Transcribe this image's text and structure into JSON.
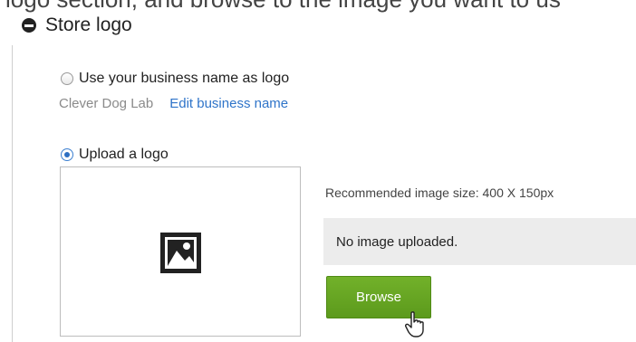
{
  "top_cut_text": "logo section, and browse to the image you want to us",
  "section": {
    "title": "Store logo",
    "collapse_icon": "minus-circle-icon"
  },
  "options": {
    "business_name_logo": {
      "label": "Use your business name as logo",
      "selected": false,
      "business_name": "Clever Dog Lab",
      "edit_link": "Edit business name"
    },
    "upload_logo": {
      "label": "Upload a logo",
      "selected": true
    }
  },
  "upload": {
    "placeholder_icon": "image-icon",
    "recommended_text": "Recommended image size: 400 X 150px",
    "status_text": "No image uploaded.",
    "browse_label": "Browse",
    "browse_color": "#66a622",
    "cursor_icon": "hand-pointer-icon"
  }
}
